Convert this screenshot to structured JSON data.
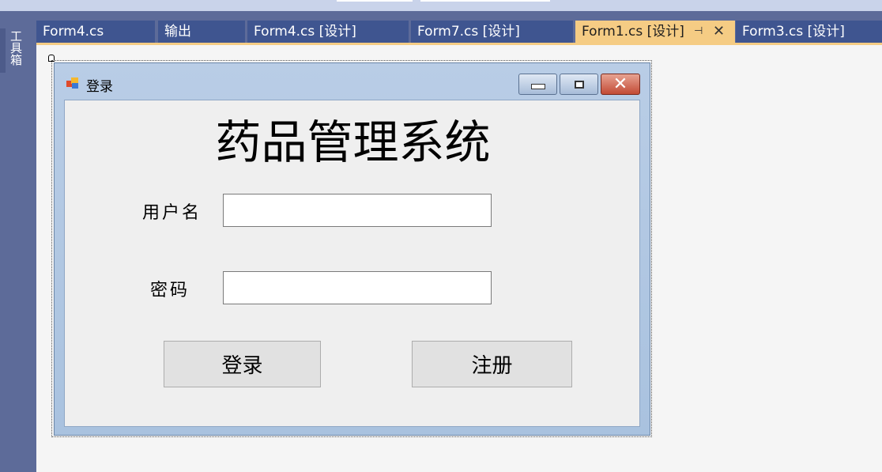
{
  "ide": {
    "toolbox_label": "工具箱",
    "tabs": [
      {
        "label": "Form4.cs",
        "active": false
      },
      {
        "label": "输出",
        "active": false
      },
      {
        "label": "Form4.cs [设计]",
        "active": false
      },
      {
        "label": "Form7.cs [设计]",
        "active": false
      },
      {
        "label": "Form1.cs [设计]",
        "active": true
      },
      {
        "label": "Form3.cs [设计]",
        "active": false
      }
    ],
    "active_tab_pin_icon": "pin-icon",
    "active_tab_close_icon": "close-icon",
    "colors": {
      "accent": "#f5cc84",
      "tab": "#3f5590",
      "rail": "#5d6b99"
    }
  },
  "form": {
    "title": "登录",
    "heading": "药品管理系统",
    "username_label": "用户名",
    "username_value": "",
    "password_label": "密码",
    "password_value": "",
    "login_button": "登录",
    "register_button": "注册"
  }
}
